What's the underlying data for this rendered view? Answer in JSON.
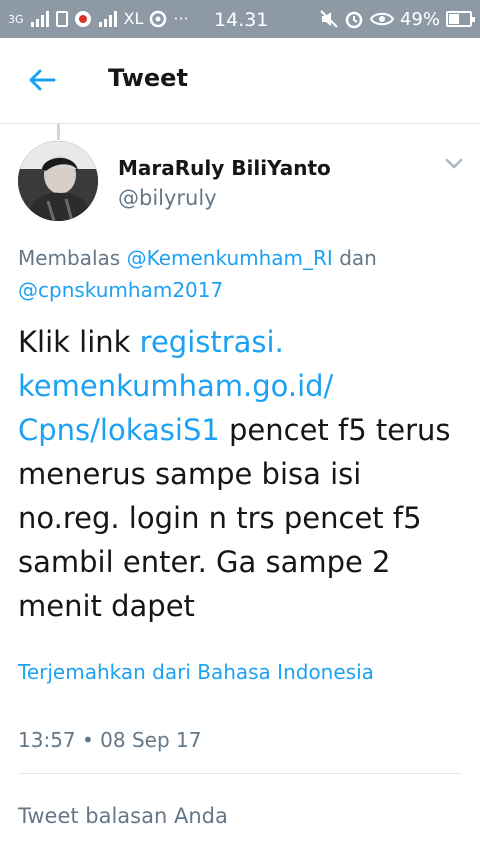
{
  "status_bar": {
    "net_label": "3G",
    "carrier": "XL",
    "more": "···",
    "time": "14.31",
    "battery": "49%",
    "battery_fill_fraction": 0.49
  },
  "app_bar": {
    "title": "Tweet"
  },
  "tweet": {
    "author_name": "MaraRuly BiliYanto",
    "author_handle": "@bilyruly",
    "reply_prefix": "Membalas",
    "reply_mention_1": "@Kemenkumham_RI",
    "reply_joiner": "dan",
    "reply_mention_2": "@cpnskumham2017",
    "body_prefix": "Klik link",
    "body_link": "registrasi.​kemenkumham.go.id/​Cpns/lokasiS1",
    "body_rest": "pencet f5 terus menerus sampe bisa isi no.reg. login n trs pencet f5 sambil enter. Ga sampe 2 menit dapet",
    "translate_label": "Terjemahkan dari Bahasa Indonesia",
    "timestamp": "13:57 • 08 Sep 17"
  },
  "reply": {
    "placeholder": "Tweet balasan Anda"
  },
  "colors": {
    "status_bar": "#8d9aa6",
    "link": "#1da1f2",
    "secondary_text": "#657786",
    "primary_text": "#14171a"
  },
  "icons": [
    "signal-icon",
    "sim-icon",
    "notification-icon",
    "mute-icon",
    "alarm-icon",
    "eye-icon",
    "battery-icon",
    "back-arrow-icon",
    "chevron-down-icon"
  ]
}
